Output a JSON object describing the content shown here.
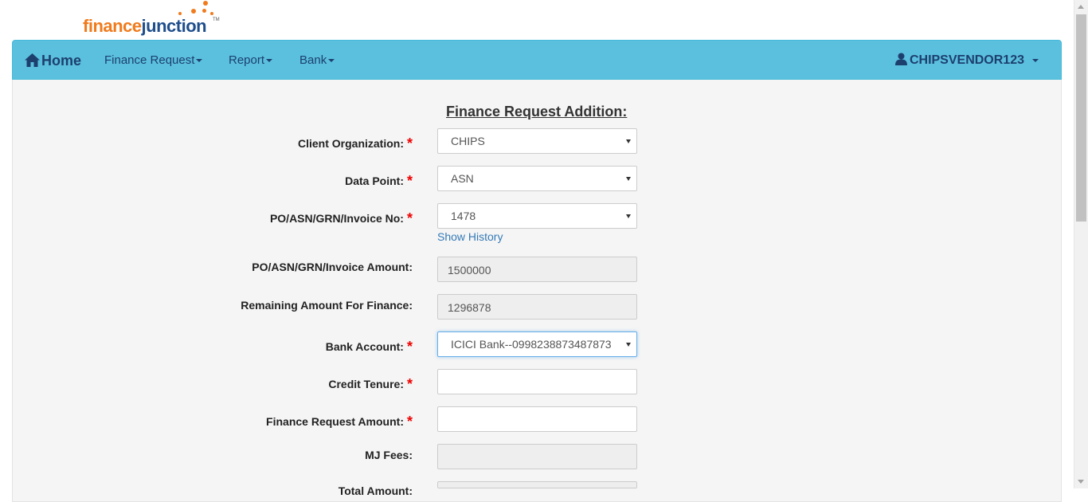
{
  "logo": {
    "part1": "finance",
    "part2": "junction",
    "tm": "TM"
  },
  "nav": {
    "home": "Home",
    "finance_request": "Finance Request",
    "report": "Report",
    "bank": "Bank",
    "user": "CHIPSVENDOR123"
  },
  "form": {
    "title": "Finance Request Addition:",
    "client_org": {
      "label": "Client Organization:",
      "value": "CHIPS"
    },
    "data_point": {
      "label": "Data Point:",
      "value": "ASN"
    },
    "po_no": {
      "label": "PO/ASN/GRN/Invoice No:",
      "value": "1478"
    },
    "show_history": "Show History",
    "po_amount": {
      "label": "PO/ASN/GRN/Invoice Amount:",
      "value": "1500000"
    },
    "remaining": {
      "label": "Remaining Amount For Finance:",
      "value": "1296878"
    },
    "bank_account": {
      "label": "Bank Account:",
      "value": "ICICI Bank--0998238873487873"
    },
    "credit_tenure": {
      "label": "Credit Tenure:",
      "value": ""
    },
    "finance_amount": {
      "label": "Finance Request Amount:",
      "value": ""
    },
    "mj_fees": {
      "label": "MJ Fees:",
      "value": ""
    },
    "total_amount": {
      "label": "Total Amount:",
      "value": ""
    },
    "required_mark": "*"
  },
  "colors": {
    "navbar": "#5bc0de",
    "required": "#ee0000",
    "link": "#337ab7",
    "brand_orange": "#f07b1d",
    "brand_blue": "#1f4e8c"
  },
  "icons": {
    "home": "home-icon",
    "user": "user-icon"
  }
}
